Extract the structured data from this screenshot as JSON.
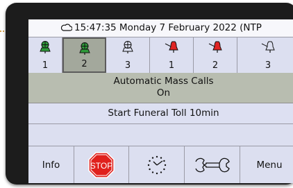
{
  "status_bar": {
    "icon": "cloud-icon",
    "datetime": "15:47:35 Monday 7 February 2022",
    "suffix": "(NTP"
  },
  "bells": [
    {
      "number": "1",
      "type": "green-bell",
      "selected": false
    },
    {
      "number": "2",
      "type": "green-bell",
      "selected": true
    },
    {
      "number": "3",
      "type": "outline-bell",
      "selected": false
    },
    {
      "number": "1",
      "type": "red-ringing-bell",
      "selected": false
    },
    {
      "number": "2",
      "type": "red-ringing-bell",
      "selected": false
    },
    {
      "number": "3",
      "type": "outline-ringing-bell",
      "selected": false
    }
  ],
  "mode_panel": {
    "title": "Automatic Mass Calls",
    "state": "On"
  },
  "toll_panel": {
    "text": "Start Funeral Toll 10min"
  },
  "toolbar": {
    "info_label": "Info",
    "stop_label": "STOP",
    "menu_label": "Menu",
    "clock_icon": "clock-icon",
    "wrench_icon": "wrench-icon"
  },
  "colors": {
    "screen_bg": "#dcdff0",
    "selected_bg": "#a3a89c",
    "mode_panel_bg": "#b8bdb0",
    "green_bell": "#2e9a3a",
    "red_bell": "#e02424",
    "stop_red": "#e0201c"
  }
}
